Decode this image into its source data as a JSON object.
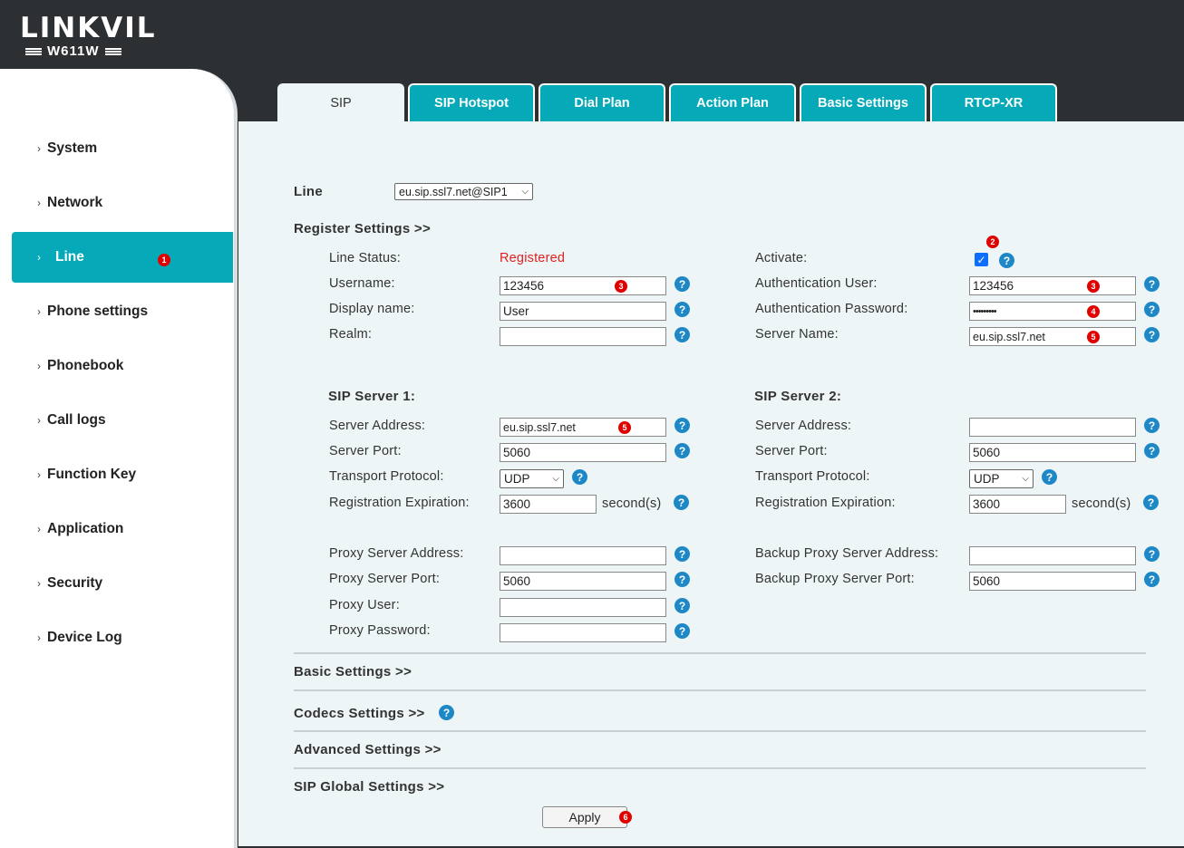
{
  "brand": {
    "name": "LINKVIL",
    "model": "W611W"
  },
  "sidebar": {
    "items": [
      {
        "label": "System"
      },
      {
        "label": "Network"
      },
      {
        "label": "Line"
      },
      {
        "label": "Phone settings"
      },
      {
        "label": "Phonebook"
      },
      {
        "label": "Call logs"
      },
      {
        "label": "Function Key"
      },
      {
        "label": "Application"
      },
      {
        "label": "Security"
      },
      {
        "label": "Device Log"
      }
    ],
    "active_index": 2
  },
  "tabs": [
    "SIP",
    "SIP Hotspot",
    "Dial Plan",
    "Action Plan",
    "Basic Settings",
    "RTCP-XR"
  ],
  "markers": {
    "m1": "1",
    "m2": "2",
    "m3": "3",
    "m4": "4",
    "m5": "5",
    "m6": "6"
  },
  "line_select": {
    "label": "Line",
    "value": "eu.sip.ssl7.net@SIP1"
  },
  "register": {
    "header": "Register Settings >>",
    "line_status_label": "Line Status:",
    "line_status_value": "Registered",
    "username_label": "Username:",
    "username_value": "123456",
    "display_name_label": "Display name:",
    "display_name_value": "User",
    "realm_label": "Realm:",
    "realm_value": "",
    "activate_label": "Activate:",
    "activate_checked": true,
    "auth_user_label": "Authentication User:",
    "auth_user_value": "123456",
    "auth_pass_label": "Authentication Password:",
    "auth_pass_value": "•••••••••",
    "server_name_label": "Server Name:",
    "server_name_value": "eu.sip.ssl7.net"
  },
  "sip_server_1": {
    "header": "SIP Server 1:",
    "address_label": "Server Address:",
    "address_value": "eu.sip.ssl7.net",
    "port_label": "Server Port:",
    "port_value": "5060",
    "transport_label": "Transport Protocol:",
    "transport_value": "UDP",
    "expiration_label": "Registration Expiration:",
    "expiration_value": "3600",
    "expiration_unit": "second(s)"
  },
  "sip_server_2": {
    "header": "SIP Server 2:",
    "address_label": "Server Address:",
    "address_value": "",
    "port_label": "Server Port:",
    "port_value": "5060",
    "transport_label": "Transport Protocol:",
    "transport_value": "UDP",
    "expiration_label": "Registration Expiration:",
    "expiration_value": "3600",
    "expiration_unit": "second(s)"
  },
  "proxy": {
    "address_label": "Proxy Server Address:",
    "address_value": "",
    "port_label": "Proxy Server Port:",
    "port_value": "5060",
    "user_label": "Proxy User:",
    "user_value": "",
    "password_label": "Proxy Password:",
    "password_value": "",
    "backup_address_label": "Backup Proxy Server Address:",
    "backup_address_value": "",
    "backup_port_label": "Backup Proxy Server Port:",
    "backup_port_value": "5060"
  },
  "sections": {
    "basic": "Basic Settings >>",
    "codecs": "Codecs Settings >>",
    "advanced": "Advanced Settings >>",
    "sip_global": "SIP Global Settings >>"
  },
  "apply_label": "Apply",
  "help_glyph": "?",
  "colors": {
    "accent": "#05a9b8",
    "header_bg": "#2d3033",
    "status_red": "#e02020",
    "help_blue": "#1e88c7"
  }
}
